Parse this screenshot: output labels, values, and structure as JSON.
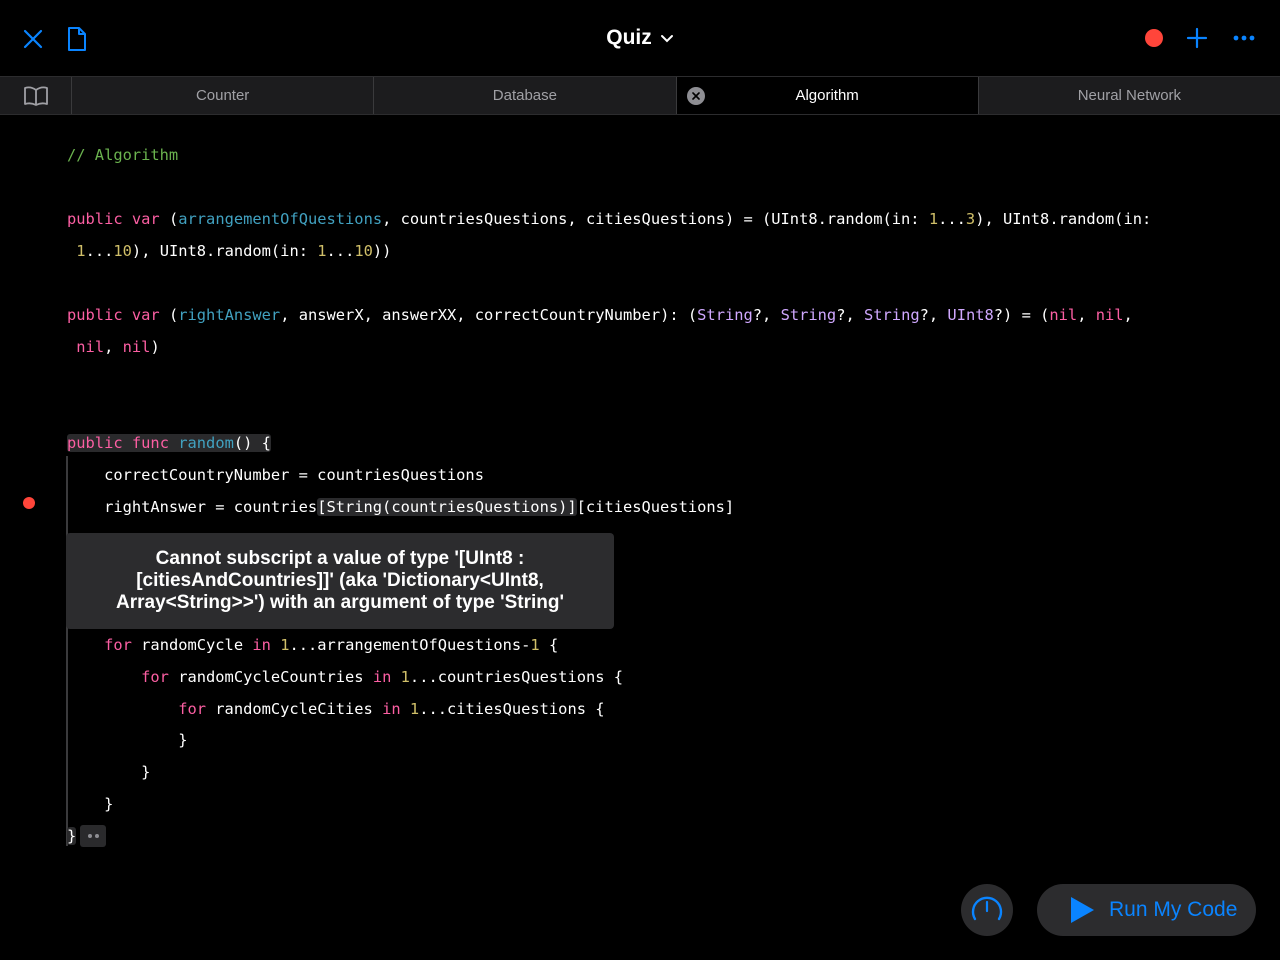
{
  "toolbar": {
    "title": "Quiz",
    "close_icon": "close-icon",
    "document_icon": "document-icon",
    "record_icon": "record-icon",
    "add_icon": "plus-icon",
    "more_icon": "more-icon",
    "accent_color": "#0a84ff",
    "record_color": "#ff453a"
  },
  "tabs": [
    {
      "label": "Counter",
      "active": false
    },
    {
      "label": "Database",
      "active": false
    },
    {
      "label": "Algorithm",
      "active": true
    },
    {
      "label": "Neural Network",
      "active": false
    }
  ],
  "editor": {
    "comment": "// Algorithm",
    "error_message": "Cannot subscript a value of type '[UInt8 : [citiesAndCountries]]' (aka 'Dictionary<UInt8, Array<String>>') with an argument of type 'String'",
    "code_lines": [
      "public var (arrangementOfQuestions, countriesQuestions, citiesQuestions) = (UInt8.random(in: 1...3), UInt8.random(in:",
      " 1...10), UInt8.random(in: 1...10))",
      "public var (rightAnswer, answerX, answerXX, correctCountryNumber): (String?, String?, String?, UInt8?) = (nil, nil,",
      " nil, nil)",
      "public func random() {",
      "    correctCountryNumber = countriesQuestions",
      "    rightAnswer = countries[String(countriesQuestions)][citiesQuestions]",
      "    for randomCycle in 1...arrangementOfQuestions-1 {",
      "        for randomCycleCountries in 1...countriesQuestions {",
      "            for randomCycleCities in 1...citiesQuestions {",
      "            }",
      "        }",
      "    }",
      "}"
    ]
  },
  "run_button": {
    "label": "Run My Code"
  }
}
